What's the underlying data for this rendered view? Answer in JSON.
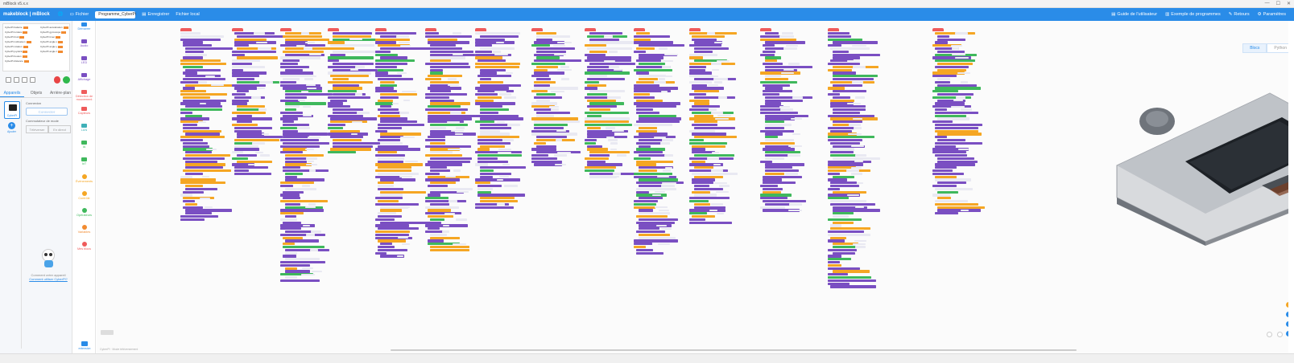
{
  "window": {
    "title": "mBlock v5.x.x",
    "controls": [
      "—",
      "☐",
      "✕"
    ]
  },
  "menubar": {
    "logo": "makeblock | mBlock",
    "file_label": "Fichier",
    "project_name": "Programme_CyberPi",
    "save_label": "Enregistrer",
    "local_file_label": "Fichier local",
    "user_guide_label": "Guide de l'utilisateur",
    "examples_label": "Exemple de programmes",
    "feedback_label": "Retours",
    "settings_label": "Paramètres",
    "color": "#2a8ce8"
  },
  "left_panel": {
    "tabs": [
      "Appareils",
      "Objets",
      "Arrière-plan"
    ],
    "active_tab": "Appareils",
    "device_name": "CyberPi",
    "add_label": "Ajouter",
    "connect_section_label": "Connexion",
    "connect_button": "Connecter",
    "mode_label": "Commutateur de mode",
    "mode_options": [
      "Téléverser",
      "En direct"
    ],
    "help_text": "Comment créer appareil",
    "help_link": "Comment utiliser CyberPi?"
  },
  "stage_monitors": [
    "CyberPi batterie",
    "CyberPi lumière",
    "CyberPi bruit",
    "CyberPi inclinaison",
    "CyberPi rotation",
    "CyberPi joystick",
    "CyberPi bouton",
    "CyberPi distance",
    "CyberPi accélération",
    "CyberPi gyroscope",
    "CyberPi timer",
    "CyberPi angle x",
    "CyberPi angle y",
    "CyberPi angle z"
  ],
  "categories": [
    {
      "label": "Démarrer",
      "color": "#2a8ce8"
    },
    {
      "label": "Audio",
      "color": "#7a4fc2"
    },
    {
      "label": "LED",
      "color": "#7a4fc2"
    },
    {
      "label": "Affichage",
      "color": "#7a4fc2"
    },
    {
      "label": "Détection de mouvement",
      "color": "#ef5b5b"
    },
    {
      "label": "Capteurs",
      "color": "#ef5b5b"
    },
    {
      "label": "LAN",
      "color": "#3fb0b8"
    },
    {
      "label": "IA",
      "color": "#3fb85c"
    },
    {
      "label": "IoT",
      "color": "#3fb85c"
    },
    {
      "label": "Évènements",
      "color": "#f5a623"
    },
    {
      "label": "Contrôle",
      "color": "#f5a623"
    },
    {
      "label": "Opérateurs",
      "color": "#3fb85c"
    },
    {
      "label": "Variables",
      "color": "#f28b30"
    },
    {
      "label": "Mes blocs",
      "color": "#ef5b5b"
    }
  ],
  "extension_label": "extension",
  "code_tabs": [
    "Blocs",
    "Python"
  ],
  "active_code_tab": "Blocs",
  "status_text": "CyberPi · Mode téléversement",
  "palette": {
    "purple": "#7a4fc2",
    "orange": "#f5a623",
    "green": "#3fb85c",
    "red": "#ef5b5b"
  }
}
